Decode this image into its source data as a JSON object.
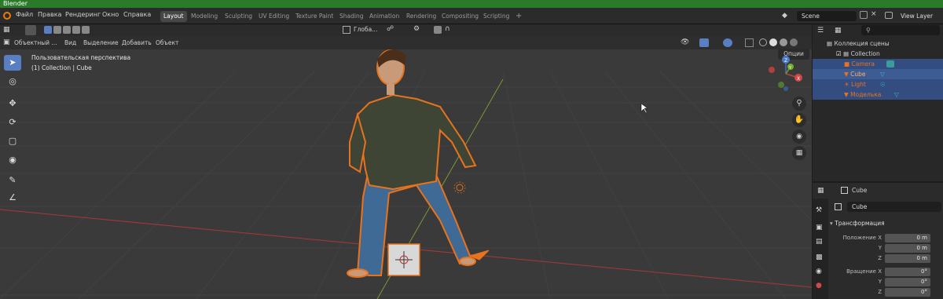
{
  "window": {
    "title": "Blender"
  },
  "menu": [
    "Файл",
    "Правка",
    "Рендеринг",
    "Окно",
    "Справка"
  ],
  "workspaces": [
    "Layout",
    "Modeling",
    "Sculpting",
    "UV Editing",
    "Texture Paint",
    "Shading",
    "Animation",
    "Rendering",
    "Compositing",
    "Scripting"
  ],
  "workspace_add": "+",
  "scene": {
    "name": "Scene",
    "view_layer": "View Layer"
  },
  "viewport": {
    "transform_orientation": "Глоба...",
    "mode": "Объектный ...",
    "menus": [
      "Вид",
      "Выделение",
      "Добавить",
      "Объект"
    ],
    "options_label": "Опции",
    "overlay_line1": "Пользовательская перспектива",
    "overlay_line2": "(1) Collection | Cube",
    "axis_labels": {
      "x": "X",
      "y": "Y",
      "z": "Z"
    }
  },
  "outliner": {
    "search_placeholder": "",
    "root": "Коллекция сцены",
    "collection": "Collection",
    "items": [
      "Camera",
      "Cube",
      "Light",
      "Моделька"
    ]
  },
  "properties": {
    "object_name_header": "Cube",
    "object_name_field": "Cube",
    "section": "Трансформация",
    "location": {
      "label_x": "Положение X",
      "label_y": "Y",
      "label_z": "Z",
      "x": "0 m",
      "y": "0 m",
      "z": "0 m"
    },
    "rotation": {
      "label_x": "Вращение X",
      "label_y": "Y",
      "label_z": "Z",
      "x": "0°",
      "y": "0°",
      "z": "0°"
    }
  },
  "colors": {
    "title_bar": "#2a7a2a",
    "selection": "#334d80",
    "active_tool": "#5a7ec2",
    "outline_orange": "#e8731c",
    "x_axis": "#a83838",
    "y_axis": "#7a9a30"
  }
}
